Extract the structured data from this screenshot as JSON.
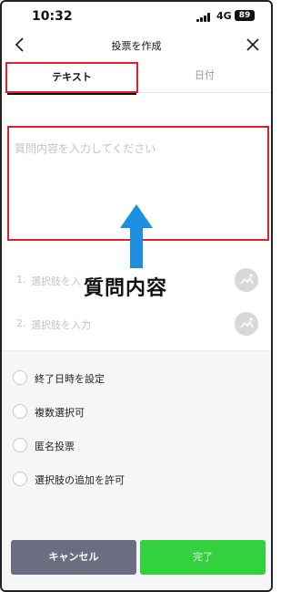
{
  "status_bar": {
    "time": "10:32",
    "network": "4G",
    "battery": "89"
  },
  "nav": {
    "title": "投票を作成",
    "back_icon": "chevron-left-icon",
    "close_icon": "close-icon"
  },
  "tabs": [
    {
      "label": "テキスト",
      "active": true
    },
    {
      "label": "日付",
      "active": false
    }
  ],
  "question": {
    "placeholder": "質問内容を入力してください"
  },
  "annotation": {
    "label": "質問内容",
    "arrow_color": "#1d8fe0"
  },
  "choices": [
    {
      "number": "1.",
      "placeholder": "選択肢を入"
    },
    {
      "number": "2.",
      "placeholder": "選択肢を入力"
    }
  ],
  "options": [
    {
      "label": "終了日時を設定"
    },
    {
      "label": "複数選択可"
    },
    {
      "label": "匿名投票"
    },
    {
      "label": "選択肢の追加を許可"
    }
  ],
  "buttons": {
    "cancel": "キャンセル",
    "done": "完了"
  },
  "colors": {
    "highlight": "#e0202b",
    "done_button": "#33d13f",
    "cancel_button": "#6b6e80"
  }
}
